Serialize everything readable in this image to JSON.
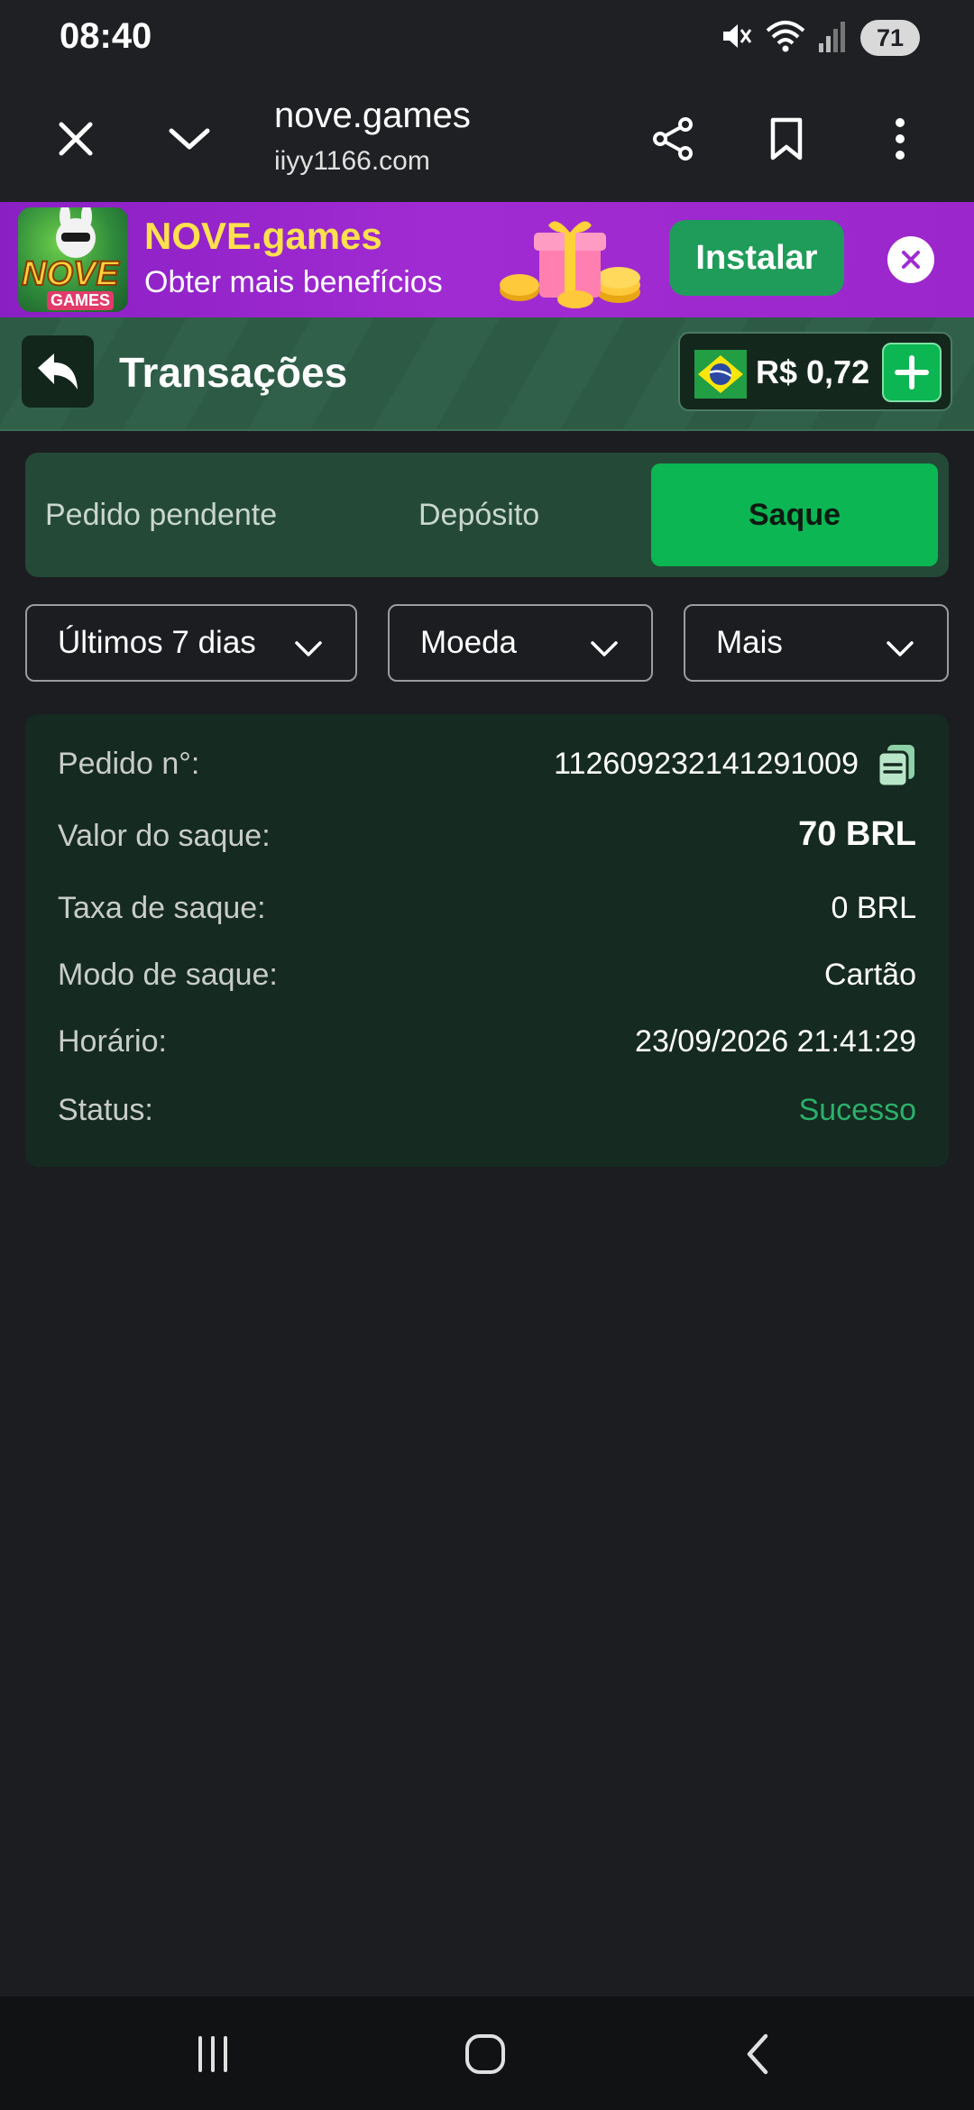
{
  "status_bar": {
    "time": "08:40",
    "battery": "71",
    "icons": [
      "mute-icon",
      "wifi-icon",
      "signal-icon",
      "battery-icon"
    ]
  },
  "browser": {
    "site_title": "nove.games",
    "site_url": "iiyy1166.com",
    "icons": [
      "close-icon",
      "chevron-down-icon",
      "share-icon",
      "bookmark-icon",
      "more-vertical-icon"
    ]
  },
  "banner": {
    "logo_text": "NOVE",
    "logo_sub": "GAMES",
    "title": "NOVE.games",
    "subtitle": "Obter mais benefícios",
    "install_label": "Instalar",
    "colors": {
      "title": "#ffe14d",
      "button": "#1f9c5a",
      "background": "#9b27cc"
    }
  },
  "header": {
    "title": "Transações",
    "balance": "R$ 0,72",
    "icons": [
      "back-arrow-icon",
      "brazil-flag-icon",
      "plus-icon"
    ]
  },
  "tabs": [
    {
      "label": "Pedido pendente",
      "active": false
    },
    {
      "label": "Depósito",
      "active": false
    },
    {
      "label": "Saque",
      "active": true
    }
  ],
  "filters": [
    {
      "label": "Últimos 7 dias"
    },
    {
      "label": "Moeda"
    },
    {
      "label": "Mais"
    }
  ],
  "transaction": {
    "order_label": "Pedido n°:",
    "order_value": "112609232141291009",
    "amount_label": "Valor do saque:",
    "amount_value": "70 BRL",
    "fee_label": "Taxa de saque:",
    "fee_value": "0 BRL",
    "mode_label": "Modo de saque:",
    "mode_value": "Cartão",
    "time_label": "Horário:",
    "time_value": "23/09/2026 21:41:29",
    "status_label": "Status:",
    "status_value": "Sucesso"
  },
  "colors": {
    "accent": "#0bb653",
    "success": "#2bb06a",
    "card_bg": "#152a20",
    "page_bg": "#1c1d21"
  },
  "nav_bar": {
    "icons": [
      "recent-apps-icon",
      "home-icon",
      "back-icon"
    ]
  }
}
